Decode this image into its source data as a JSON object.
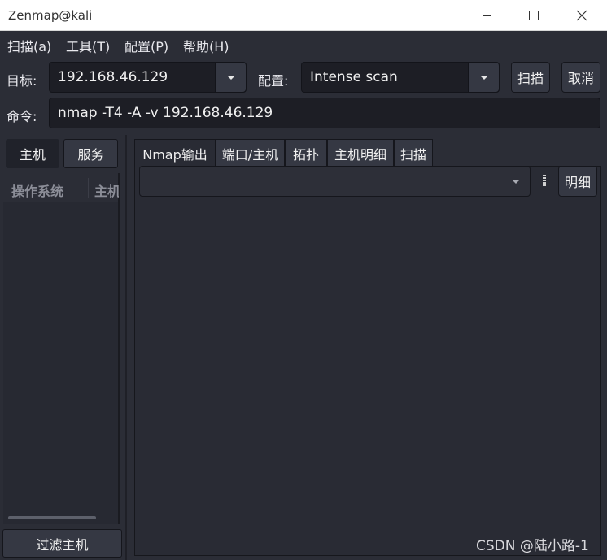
{
  "window": {
    "title": "Zenmap@kali"
  },
  "menu": {
    "items": [
      "扫描(a)",
      "工具(T)",
      "配置(P)",
      "帮助(H)"
    ]
  },
  "toolbar": {
    "target_label": "目标:",
    "target_value": "192.168.46.129",
    "profile_label": "配置:",
    "profile_value": "Intense scan",
    "scan_button": "扫描",
    "cancel_button": "取消",
    "command_label": "命令:",
    "command_value": "nmap -T4 -A -v 192.168.46.129"
  },
  "left_panel": {
    "tabs": [
      "主机",
      "服务"
    ],
    "columns": [
      "操作系统",
      "主机"
    ],
    "filter_button": "过滤主机"
  },
  "right_panel": {
    "tabs": [
      "Nmap输出",
      "端口/主机",
      "拓扑",
      "主机明细",
      "扫描"
    ],
    "active_tab": "Nmap输出",
    "output_select_value": "",
    "detail_button": "明细"
  },
  "watermark": "CSDN @陆小路-1",
  "colors": {
    "app_background": "#2b2d36",
    "input_background": "#1d1e25",
    "button_background": "#353843"
  }
}
